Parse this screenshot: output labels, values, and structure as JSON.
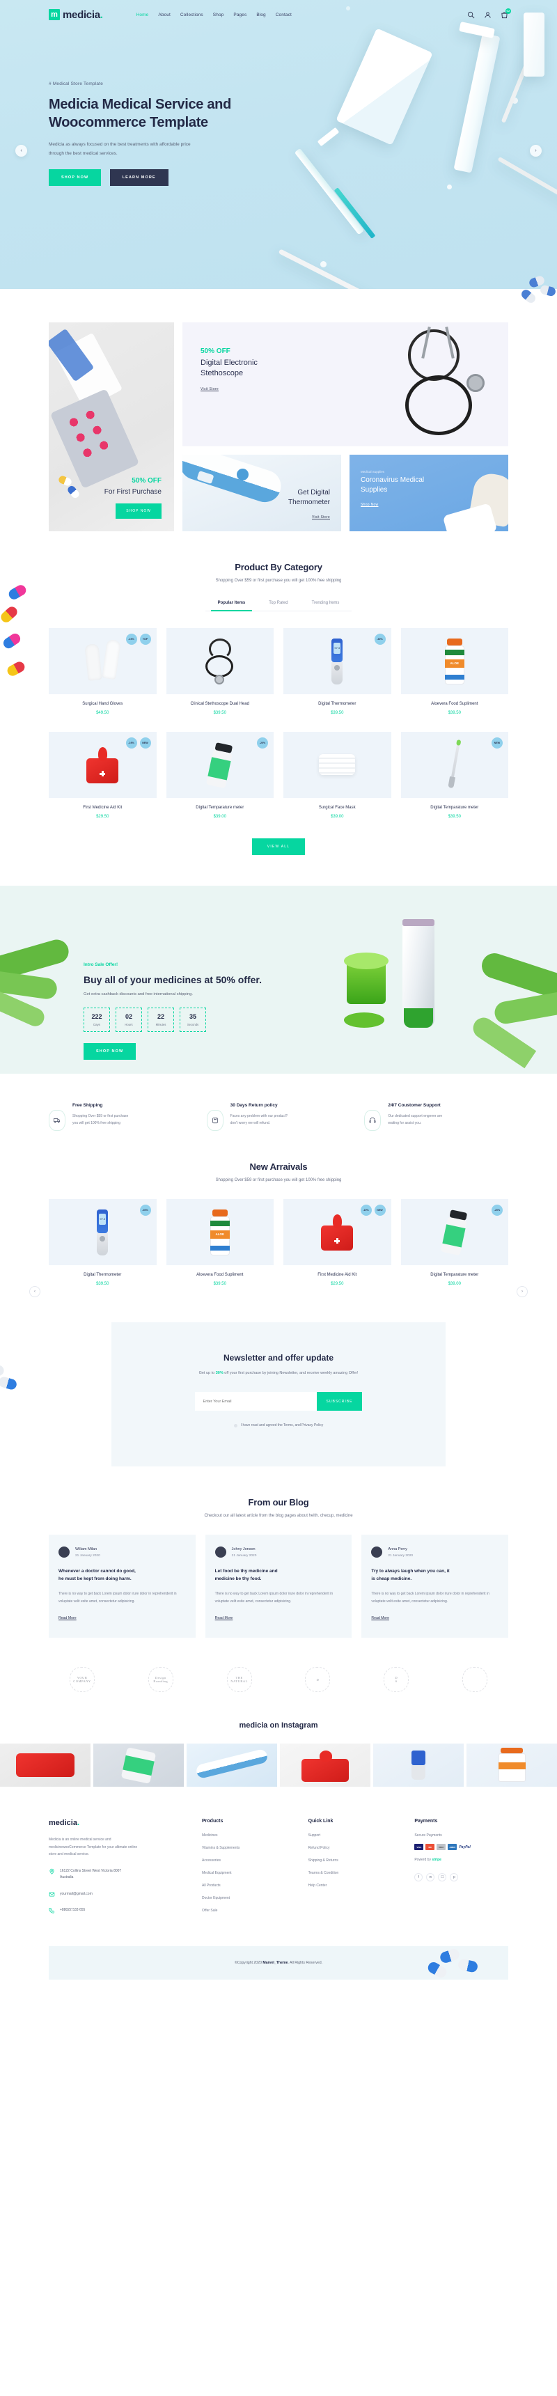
{
  "brand": {
    "name": "medicia",
    "dot": ".",
    "mark": "m"
  },
  "nav": {
    "items": [
      "Home",
      "About",
      "Collections",
      "Shop",
      "Pages",
      "Blog",
      "Contact"
    ],
    "cart_count": "02",
    "icons": [
      "search-icon",
      "user-icon",
      "cart-icon"
    ]
  },
  "hero": {
    "eyebrow": "# Medical Store Template",
    "title_line1": "Medicia Medical Service and",
    "title_line2": "Woocommerce Template",
    "desc_line1": "Medicia as always focused on the best treatments with affordable price",
    "desc_line2": "through the best medical services.",
    "primary_btn": "SHOP NOW",
    "secondary_btn": "LEARN MORE",
    "prev": "‹",
    "next": "›"
  },
  "promo": {
    "left": {
      "off": "50% OFF",
      "title": "For First Purchase",
      "cta": "SHOP NOW"
    },
    "top": {
      "off": "50% OFF",
      "title_l1": "Digital Electronic",
      "title_l2": "Stethoscope",
      "cta": "Visit Store"
    },
    "thermometer": {
      "title_l1": "Get Digital",
      "title_l2": "Thermometer",
      "cta": "Visit Store"
    },
    "corona": {
      "label": "Medical Supplies",
      "title_l1": "Coronavirus Medical",
      "title_l2": "Supplies",
      "cta": "Shop Now"
    }
  },
  "category": {
    "title": "Product By Category",
    "subtitle": "Shopping Over $59 or first purchase you will get 100% free shipping",
    "tabs": [
      "Popular Items",
      "Top Rated",
      "Trending Items"
    ],
    "active_tab": "Popular Items",
    "view_all": "VIEW ALL",
    "products": [
      {
        "name": "Surgical Hand Gloves",
        "price": "$49.50",
        "badges": [
          "-19%",
          "TOP"
        ],
        "img": "gloves"
      },
      {
        "name": "Clinical Stethoscope Dual Head",
        "price": "$39.50",
        "badges": [],
        "img": "stethoscope"
      },
      {
        "name": "Digital Thermometer",
        "price": "$39.50",
        "badges": [
          "-30%"
        ],
        "img": "thermometer"
      },
      {
        "name": "Aloevera Food Supliment",
        "price": "$39.50",
        "badges": [],
        "img": "aloe"
      },
      {
        "name": "First Medicine Aid Kit",
        "price": "$29.50",
        "badges": [
          "-19%",
          "NEW"
        ],
        "img": "aidkit"
      },
      {
        "name": "Digital Temparature meter",
        "price": "$39.00",
        "badges": [
          "-20%"
        ],
        "img": "pillbottle"
      },
      {
        "name": "Surgical Face Mask",
        "price": "$39.00",
        "badges": [],
        "img": "mask"
      },
      {
        "name": "Digital Temparature meter",
        "price": "$39.50",
        "badges": [
          "NEW"
        ],
        "img": "pen"
      }
    ]
  },
  "offer": {
    "eyebrow": "Intro Sale Offer!",
    "title": "Buy all of your medicines at 50% offer.",
    "desc": "Get extra cashback discounts and free international shipping.",
    "countdown": [
      {
        "value": "222",
        "label": "Days"
      },
      {
        "value": "02",
        "label": "Hours"
      },
      {
        "value": "22",
        "label": "Minutes"
      },
      {
        "value": "35",
        "label": "Seconds"
      }
    ],
    "cta": "SHOP NOW"
  },
  "features": [
    {
      "icon": "truck-icon",
      "title": "Free Shipping",
      "desc_l1": "Shopping Over $59 or first purchase",
      "desc_l2": "you will get 100% free shipping"
    },
    {
      "icon": "box-icon",
      "title": "30 Days Return policy",
      "desc_l1": "Faces any problem with our product?",
      "desc_l2": "don't worry we will refund."
    },
    {
      "icon": "headset-icon",
      "title": "24/7 Coustomer Support",
      "desc_l1": "Our dedicated support engneer are",
      "desc_l2": "waiting for assist you."
    }
  ],
  "new_arrivals": {
    "title": "New Arraivals",
    "subtitle": "Shopping Over $59 or first purchase you will get 100% free shipping",
    "prev": "‹",
    "next": "›",
    "products": [
      {
        "name": "Digital Thermometer",
        "price": "$39.50",
        "badges": [
          "-30%"
        ],
        "img": "thermometer"
      },
      {
        "name": "Aloevera Food Supliment",
        "price": "$39.50",
        "badges": [],
        "img": "aloe"
      },
      {
        "name": "First Medicine Aid Kit",
        "price": "$29.50",
        "badges": [
          "-19%",
          "NEW"
        ],
        "img": "aidkit"
      },
      {
        "name": "Digital Temparature meter",
        "price": "$39.00",
        "badges": [
          "-20%"
        ],
        "img": "pillbottle"
      }
    ]
  },
  "newsletter": {
    "title": "Newsletter and offer update",
    "sub_pre": "Get up to ",
    "sub_highlight": "30%",
    "sub_post": " off your first purchase by joining Newsletter, and receive weekly amazing Offer!",
    "placeholder": "Enter Your Email",
    "value": "",
    "button": "SUBSCRIBE",
    "consent": "I have read and agreed the Terms, and Privacy Policy"
  },
  "blog": {
    "title": "From our Blog",
    "subtitle": "Checkout our all latest article from the blog pages about helth. checup, medicine",
    "posts": [
      {
        "author": "Wiliam Milan",
        "date": "21 January 2020",
        "heading_l1": "Whenever a doctor cannot do good,",
        "heading_l2": "he must be kept from doing harm.",
        "excerpt": "There is no way to get back Lorem ipsum dolor irure dolor in reprehenderit in voluptate velit esite amet, consectetur adipisicing.",
        "cta": "Read More"
      },
      {
        "author": "Johny Jonson",
        "date": "21 January 2020",
        "heading_l1": "Let food be thy medicine and",
        "heading_l2": "medicine be thy food.",
        "excerpt": "There is no way to get back Lorem ipsum dolor irure dolor in reprehenderit in voluptate velit esite amet, consectetur adipisicing.",
        "cta": "Read More"
      },
      {
        "author": "Anna Perry",
        "date": "21 January 2020",
        "heading_l1": "Try to always laugh when you can, it",
        "heading_l2": "is cheap medicine.",
        "excerpt": "There is no way to get back Lorem ipsum dolor irure dolor in reprehenderit in voluptate velit esite amet, consectetur adipisicing.",
        "cta": "Read More"
      }
    ]
  },
  "brands": [
    {
      "name": "your-company-logo",
      "l1": "YOUR",
      "l2": "COMPANY"
    },
    {
      "name": "design-and-branding-logo",
      "l1": "Design",
      "l2": "Branding"
    },
    {
      "name": "the-natural-logo",
      "l1": "THE",
      "l2": "NATURAL"
    },
    {
      "name": "d-floral-logo",
      "l1": "D",
      "l2": ""
    },
    {
      "name": "ds-studio-logo",
      "l1": "D",
      "l2": "S"
    },
    {
      "name": "coffee-house-logo",
      "l1": "",
      "l2": ""
    }
  ],
  "instagram": {
    "title": "medicia on Instagram",
    "items": [
      "aid-kit-open",
      "pills-bottle-mockup",
      "ear-thermometer",
      "red-aid-kit",
      "digital-thermometer",
      "aloe-vera-bottle"
    ]
  },
  "footer": {
    "brand": "medicia",
    "dot": ".",
    "description": "Medicia is an online medical service and medicinewooCommerce Template for your ultimate online store and medical service.",
    "address_l1": "16122 Collins Street West Victoria 8007",
    "address_l2": "Australia",
    "email": "yourmail@gmail.com",
    "phone": "+88022 533 655",
    "columns": [
      {
        "title": "Products",
        "links": [
          "Medicines",
          "Vitamins & Supplements",
          "Accessories",
          "Medical Equipment",
          "All Products",
          "Doctor Equipment",
          "Offer Sale"
        ]
      },
      {
        "title": "Quick Link",
        "links": [
          "Support",
          "Refund Policy",
          "Shipping & Returns",
          "Tearms & Condition",
          "Help Center"
        ]
      }
    ],
    "payments": {
      "title": "Payments",
      "secure_label": "Secure Payments",
      "cards": [
        "VISA",
        "MC",
        "DISC",
        "AMEX",
        "PayPal"
      ],
      "powered_pre": "Powerd by ",
      "powered_brand": "stripe",
      "socials": [
        "facebook-icon",
        "twitter-icon",
        "instagram-icon",
        "pinterest-icon"
      ]
    },
    "copyright_pre": "©Copyright 2020 ",
    "copyright_brand": "Marvel_Theme",
    "copyright_post": ". All Rights Reserved."
  },
  "colors": {
    "accent": "#06d6a0",
    "dark": "#232946",
    "hero_bg": "#c3e4f1",
    "badge": "#8fd0ec"
  }
}
